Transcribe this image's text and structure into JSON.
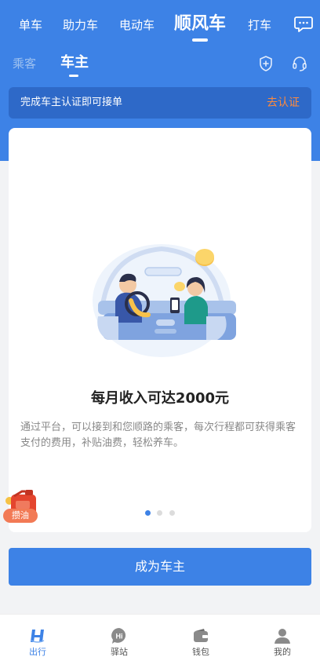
{
  "top_nav": {
    "items": [
      {
        "label": "单车"
      },
      {
        "label": "助力车"
      },
      {
        "label": "电动车"
      },
      {
        "label": "顺风车",
        "active": true
      },
      {
        "label": "打车"
      }
    ],
    "message_icon": "message-icon"
  },
  "role_tabs": {
    "passenger": "乘客",
    "owner": "车主",
    "active": "owner"
  },
  "header_icons": [
    "shield-plus-icon",
    "headset-icon"
  ],
  "cert_banner": {
    "text": "完成车主认证即可接单",
    "action": "去认证"
  },
  "card": {
    "title": "每月收入可达2000元",
    "description": "通过平台，可以接到和您顺路的乘客，每次行程都可获得乘客支付的费用，补贴油费，轻松养车。",
    "illustration": "driver-passenger-car-illustration",
    "carousel": {
      "count": 3,
      "active_index": 0
    }
  },
  "fuel_badge": {
    "label": "攒油",
    "icon": "fuel-can-icon"
  },
  "cta": {
    "label": "成为车主"
  },
  "bottom_tabs": [
    {
      "label": "出行",
      "icon": "h-logo-icon",
      "active": true
    },
    {
      "label": "驿站",
      "icon": "hi-bubble-icon"
    },
    {
      "label": "钱包",
      "icon": "wallet-icon"
    },
    {
      "label": "我的",
      "icon": "person-icon"
    }
  ],
  "colors": {
    "brand_blue": "#3d82e6",
    "accent_orange": "#ff8a3d",
    "fuel_badge": "#f27a55"
  }
}
